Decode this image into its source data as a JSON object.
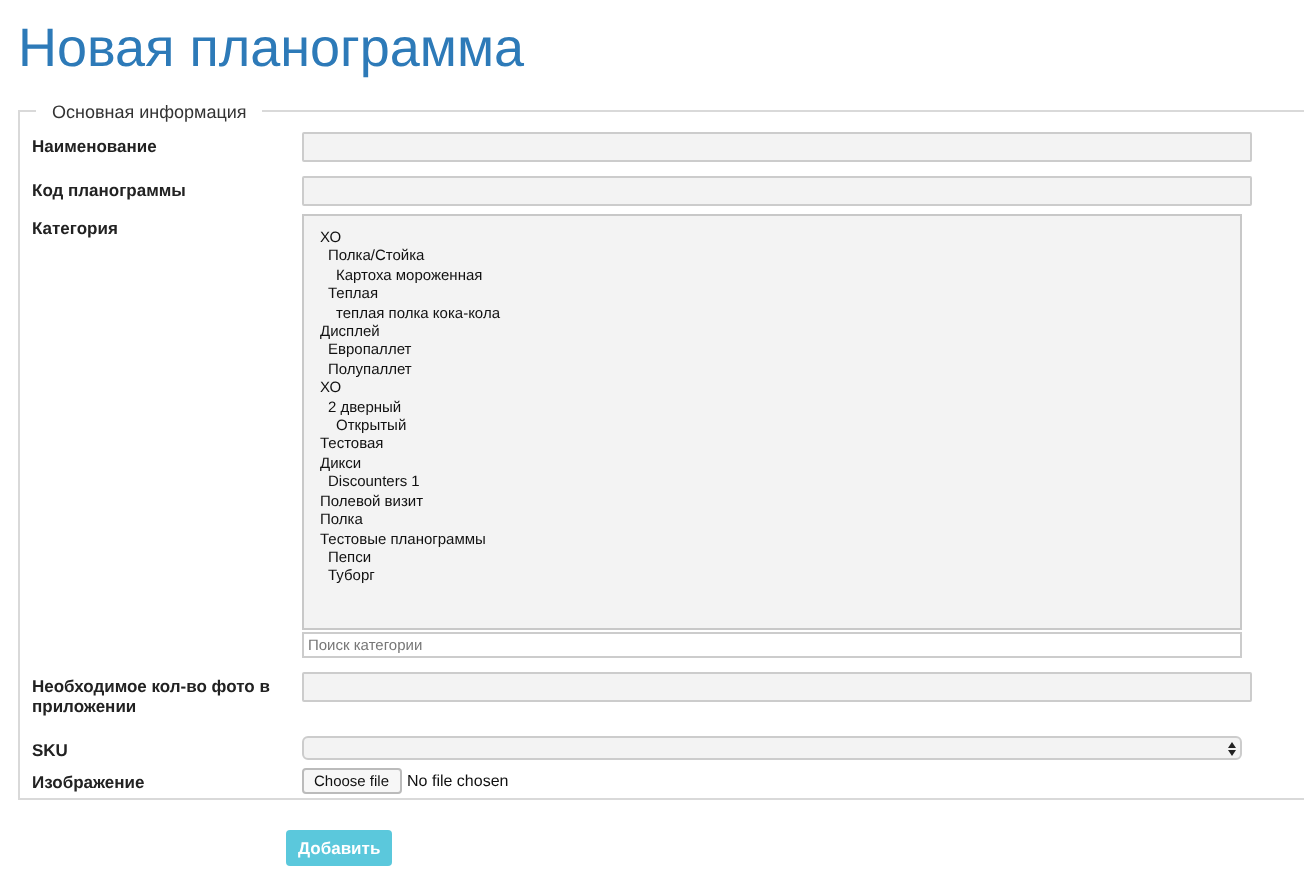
{
  "title": "Новая планограмма",
  "fieldset": {
    "legend": "Основная информация",
    "fields": [
      {
        "kind": "text",
        "label": "Наименование"
      },
      {
        "kind": "text",
        "label": "Код планограммы"
      },
      {
        "kind": "tree",
        "label": "Категория",
        "search_placeholder": "Поиск категории",
        "categories": [
          {
            "label": "ХО",
            "children": [
              {
                "label": "Полка/Стойка",
                "children": [
                  {
                    "label": "Картоха мороженная"
                  }
                ]
              },
              {
                "label": "Теплая",
                "children": [
                  {
                    "label": "теплая полка кока-кола"
                  }
                ]
              }
            ]
          },
          {
            "label": "Дисплей",
            "children": [
              {
                "label": "Европаллет"
              },
              {
                "label": "Полупаллет"
              }
            ]
          },
          {
            "label": "ХО",
            "children": [
              {
                "label": "2 дверный",
                "children": [
                  {
                    "label": "Открытый"
                  }
                ]
              }
            ]
          },
          {
            "label": "Тестовая"
          },
          {
            "label": "Дикси",
            "children": [
              {
                "label": "Discounters 1"
              }
            ]
          },
          {
            "label": "Полевой визит"
          },
          {
            "label": "Полка"
          },
          {
            "label": "Тестовые планограммы",
            "children": [
              {
                "label": "Пепси"
              },
              {
                "label": "Туборг"
              }
            ]
          }
        ]
      },
      {
        "kind": "text",
        "label": "Необходимое кол-во фото в приложении"
      },
      {
        "kind": "select",
        "label": "SKU"
      },
      {
        "kind": "file",
        "label": "Изображение",
        "button": "Choose file",
        "status": "No file chosen"
      }
    ]
  },
  "submit": "Добавить"
}
